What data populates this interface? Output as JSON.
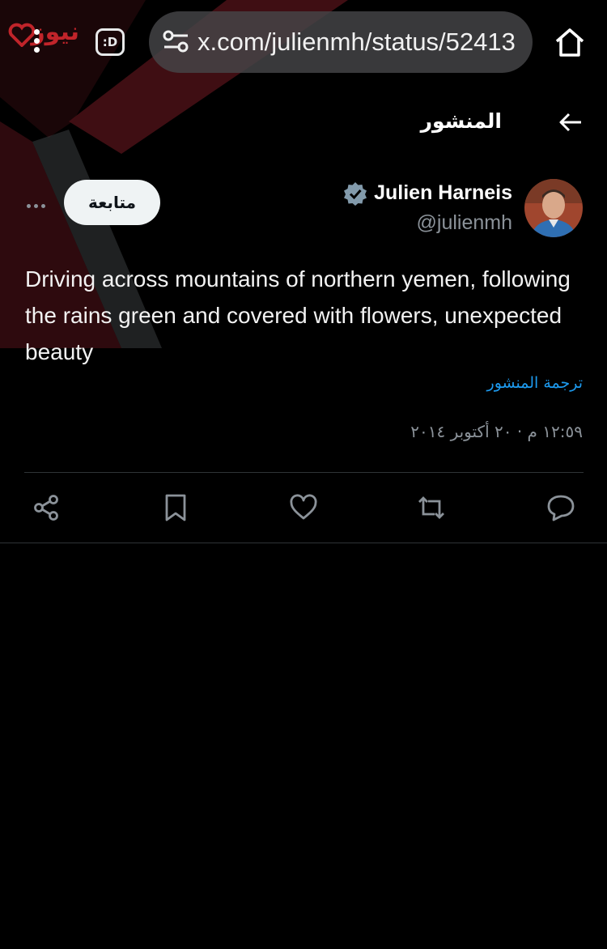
{
  "watermark": {
    "text": "نيوز"
  },
  "browser": {
    "tab_icon_label": ":D",
    "url": "x.com/julienmh/status/52413"
  },
  "header": {
    "title": "المنشور"
  },
  "post": {
    "author_name": "Julien Harneis",
    "author_handle": "@julienmh",
    "follow_label": "متابعة",
    "text": "Driving across mountains of northern yemen, following the rains green and covered with flowers, unexpected beauty",
    "translate_label": "ترجمة المنشور",
    "timestamp": "١٢:٥٩ م · ٢٠ أكتوبر ٢٠١٤"
  },
  "actions": [
    "share-icon",
    "bookmark-icon",
    "like-icon",
    "repost-icon",
    "reply-icon"
  ],
  "colors": {
    "accent": "#1d9bf0",
    "watermark_red": "#c0242a"
  }
}
